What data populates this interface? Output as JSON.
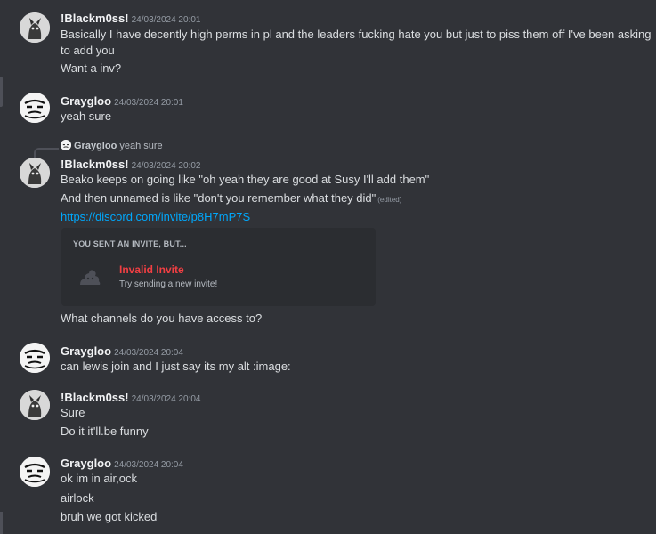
{
  "messages": [
    {
      "author": "!Blackm0ss!",
      "timestamp": "24/03/2024 20:01",
      "lines": [
        "Basically I have decently high perms in pl and the leaders fucking hate you but just to piss them off I've been asking",
        "to add you",
        "Want a inv?"
      ]
    },
    {
      "author": "Graygloo",
      "timestamp": "24/03/2024 20:01",
      "lines": [
        "yeah sure"
      ]
    },
    {
      "reply": {
        "author": "Graygloo",
        "text": "yeah sure"
      },
      "author": "!Blackm0ss!",
      "timestamp": "24/03/2024 20:02",
      "lines": [
        "Beako keeps on going like \"oh yeah they are good at Susy I'll add them\"",
        "And then unnamed is like \"don't you remember what they did\"",
        "https://discord.com/invite/p8H7mP7S",
        "What channels do you have access to?"
      ],
      "edited_label": "(edited)",
      "invite": {
        "title": "YOU SENT AN INVITE, BUT...",
        "name": "Invalid Invite",
        "subtitle": "Try sending a new invite!"
      }
    },
    {
      "author": "Graygloo",
      "timestamp": "24/03/2024 20:04",
      "lines": [
        "can lewis join and I just say its my alt :image:"
      ]
    },
    {
      "author": "!Blackm0ss!",
      "timestamp": "24/03/2024 20:04",
      "lines": [
        "Sure",
        "Do it it'll.be funny"
      ]
    },
    {
      "author": "Graygloo",
      "timestamp": "24/03/2024 20:04",
      "lines": [
        "ok im in air,ock",
        "airlock",
        "bruh we got kicked"
      ]
    }
  ],
  "colors": {
    "background": "#313338",
    "link": "#00a8fc",
    "invalid": "#f23f43"
  }
}
